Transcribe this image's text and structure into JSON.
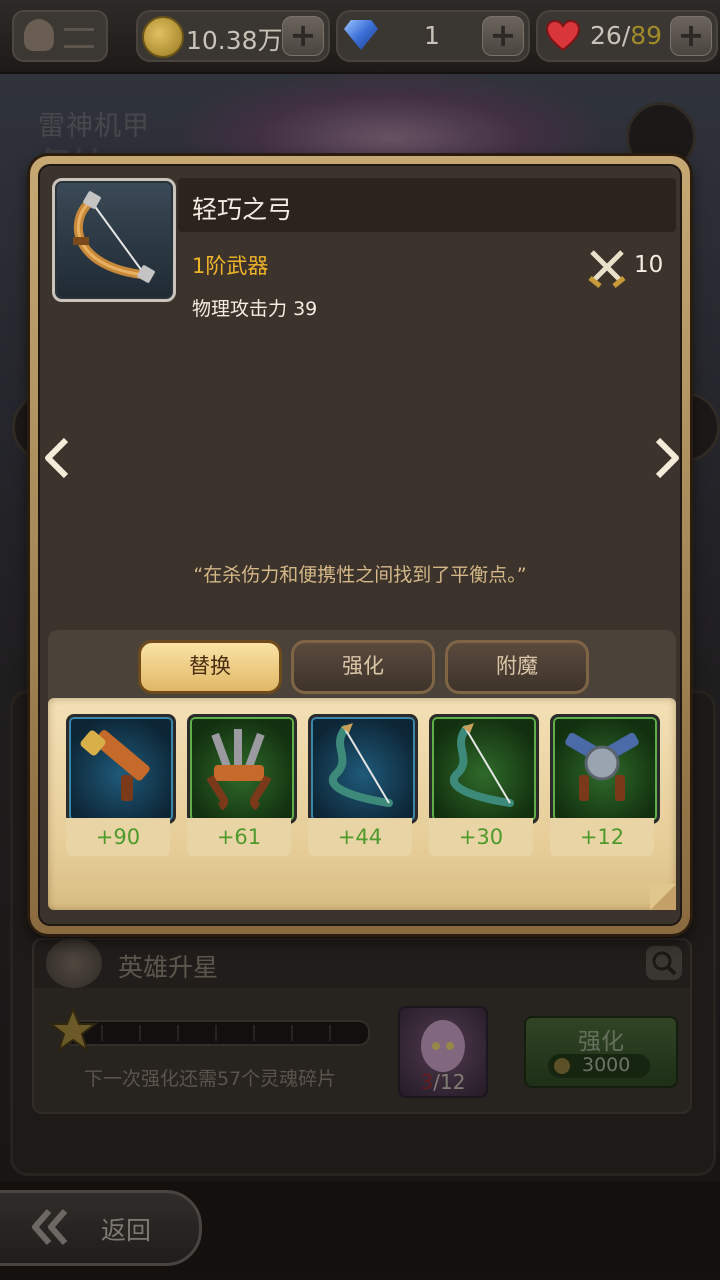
{
  "resources": {
    "gold": "10.38万",
    "gems": "1",
    "stamina_current": "26",
    "stamina_max": "89"
  },
  "background": {
    "hero_title": "雷神机甲",
    "hero_name_partial": "伊妹"
  },
  "item": {
    "name": "轻巧之弓",
    "tier": "1阶武器",
    "stat_label": "物理攻击力",
    "stat_value": "39",
    "power": "10",
    "description": "“在杀伤力和便携性之间找到了平衡点。”"
  },
  "tabs": [
    {
      "label": "替换",
      "active": true
    },
    {
      "label": "强化",
      "active": false
    },
    {
      "label": "附魔",
      "active": false
    }
  ],
  "replacements": [
    {
      "icon": "bazooka-icon",
      "bonus": "+90",
      "frame": "blue"
    },
    {
      "icon": "multi-crossbow-icon",
      "bonus": "+61",
      "frame": "green"
    },
    {
      "icon": "serpent-bow-icon",
      "bonus": "+44",
      "frame": "blue"
    },
    {
      "icon": "serpent-bow-icon",
      "bonus": "+30",
      "frame": "green"
    },
    {
      "icon": "twin-cannon-icon",
      "bonus": "+12",
      "frame": "green"
    }
  ],
  "star_up": {
    "title": "英雄升星",
    "progress_text": "下一次强化还需57个灵魂碎片",
    "shards_have": "3",
    "shards_need": "/12",
    "upgrade_label": "强化",
    "upgrade_cost": "3000"
  },
  "back_label": "返回",
  "colors": {
    "tier": "#f0b428",
    "bonus": "#4e9a2a",
    "desc": "#d4b787"
  }
}
